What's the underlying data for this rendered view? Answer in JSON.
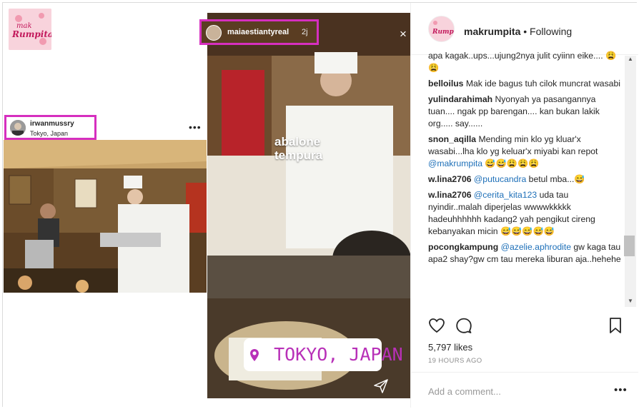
{
  "logo": {
    "text": "mak rumpita"
  },
  "post": {
    "username": "irwanmussry",
    "location": "Tokyo, Japan",
    "more": "•••"
  },
  "story": {
    "username": "maiaestiantyreal",
    "time": "2j",
    "close": "×",
    "sticker_line1": "abalone",
    "sticker_line2": "tempura",
    "location_sticker": "TOKYO, JAPAN"
  },
  "pane": {
    "username": "makrumpita",
    "separator": " • ",
    "follow_status": "Following",
    "comments": [
      {
        "user": "",
        "mention": "",
        "text": "apa kagak..ups...ujung2nya julit cyiinn eike.... 😩😩"
      },
      {
        "user": "belloilus",
        "mention": "",
        "text": "Mak ide bagus tuh cilok muncrat wasabi"
      },
      {
        "user": "yulindarahimah",
        "mention": "",
        "text": "Nyonyah ya pasangannya tuan.... ngak pp barengan.... kan bukan lakik org..... say......"
      },
      {
        "user": "snon_aqilla",
        "mention": "@makrumpita",
        "text": "Mending min klo yg kluar'x wasabi...lha klo yg keluar'x miyabi kan repot",
        "after": " 😅😅😩😩😩"
      },
      {
        "user": "w.lina2706",
        "mention": "@putucandra",
        "text": "",
        "after": " betul mba...😅"
      },
      {
        "user": "w.lina2706",
        "mention": "@cerita_kita123",
        "text": "",
        "after": " uda tau nyindir..malah diperjelas wwwwkkkkk hadeuhhhhhh kadang2 yah pengikut cireng kebanyakan micin 😅😅😅😅😅"
      },
      {
        "user": "pocongkampung",
        "mention": "@azelie.aphrodite",
        "text": "",
        "after": " gw kaga tau apa2 shay?gw cm tau mereka liburan aja..hehehe"
      }
    ],
    "likes": "5,797 likes",
    "time": "19 HOURS AGO",
    "add_comment_placeholder": "Add a comment...",
    "more": "•••"
  },
  "colors": {
    "highlight": "#d62fbf",
    "mention": "#1d6fb8",
    "location_text": "#b830b8"
  }
}
